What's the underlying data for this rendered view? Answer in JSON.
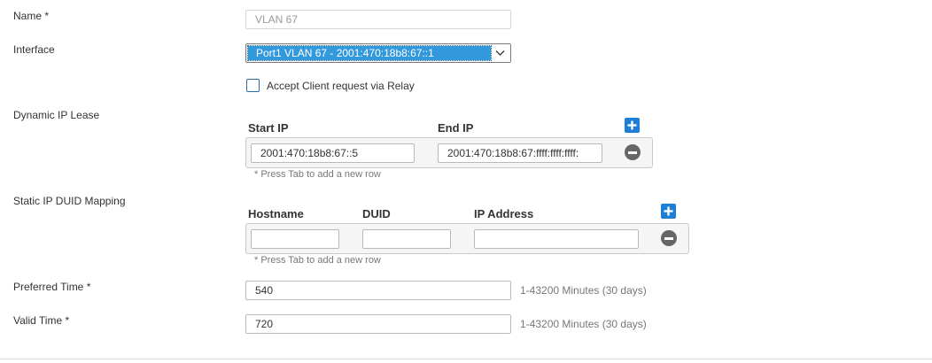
{
  "name": {
    "label": "Name *",
    "value": "VLAN 67"
  },
  "interface": {
    "label": "Interface",
    "selected": "Port1 VLAN 67 - 2001:470:18b8:67::1"
  },
  "relay": {
    "label": "Accept Client request via Relay",
    "checked": false
  },
  "dynamic_lease": {
    "label": "Dynamic IP Lease",
    "start_ip_header": "Start IP",
    "end_ip_header": "End IP",
    "rows": [
      {
        "start_ip": "2001:470:18b8:67::5",
        "end_ip": "2001:470:18b8:67:ffff:ffff:ffff:"
      }
    ],
    "hint": "* Press Tab to add a new row"
  },
  "static_mapping": {
    "label": "Static IP DUID Mapping",
    "hostname_header": "Hostname",
    "duid_header": "DUID",
    "ip_header": "IP Address",
    "rows": [
      {
        "hostname": "",
        "duid": "",
        "ip": ""
      }
    ],
    "hint": "* Press Tab to add a new row"
  },
  "preferred_time": {
    "label": "Preferred Time *",
    "value": "540",
    "note": "1-43200 Minutes (30 days)"
  },
  "valid_time": {
    "label": "Valid Time *",
    "value": "720",
    "note": "1-43200 Minutes (30 days)"
  },
  "colors": {
    "accent": "#1c7ed6",
    "selection": "#3399dd",
    "remove": "#666666"
  },
  "icons": {
    "add": "plus-icon",
    "remove": "minus-icon",
    "dropdown": "chevron-down-icon"
  }
}
